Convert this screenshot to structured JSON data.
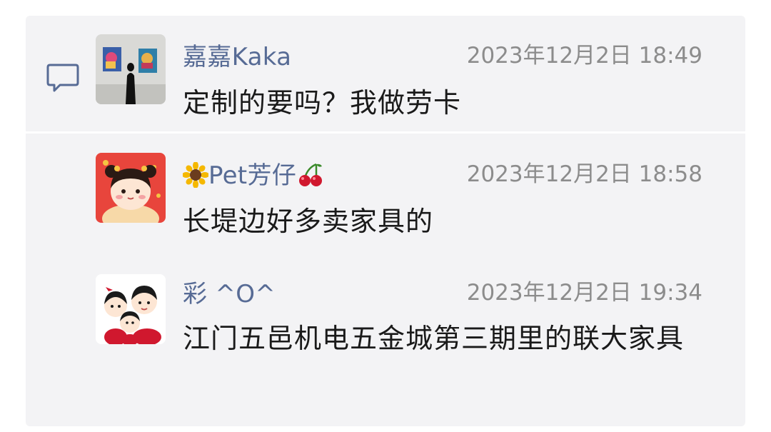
{
  "comments": [
    {
      "name": "嘉嘉Kaka",
      "time": "2023年12月2日 18:49",
      "text": "定制的要吗？我做劳卡",
      "avatar_icon": "gallery-photo-avatar"
    },
    {
      "name_prefix_icon": "sunflower-emoji",
      "name": "Pet芳仔",
      "name_suffix_icon": "cherries-emoji",
      "time": "2023年12月2日 18:58",
      "text": "长堤边好多卖家具的",
      "avatar_icon": "cartoon-girl-avatar"
    },
    {
      "name": "彩 ^O^",
      "time": "2023年12月2日 19:34",
      "text": "江门五邑机电五金城第三期里的联大家具",
      "avatar_icon": "cartoon-family-avatar"
    }
  ],
  "colors": {
    "name": "#576b95",
    "time": "#8c8c8c",
    "text": "#1a1a1a",
    "panel": "#f3f3f5"
  }
}
